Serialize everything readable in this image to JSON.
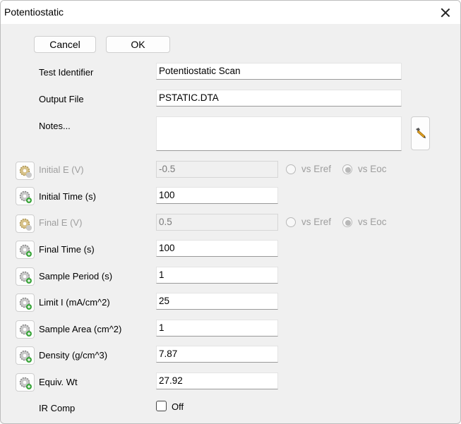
{
  "window": {
    "title": "Potentiostatic"
  },
  "buttons": {
    "cancel": "Cancel",
    "ok": "OK"
  },
  "fields": {
    "test_identifier": {
      "label": "Test Identifier",
      "value": "Potentiostatic Scan"
    },
    "output_file": {
      "label": "Output File",
      "value": "PSTATIC.DTA"
    },
    "notes": {
      "label": "Notes...",
      "value": ""
    },
    "initial_e": {
      "label": "Initial E (V)",
      "value": "-0.5",
      "enabled": false
    },
    "initial_time": {
      "label": "Initial Time (s)",
      "value": "100"
    },
    "final_e": {
      "label": "Final E (V)",
      "value": "0.5",
      "enabled": false
    },
    "final_time": {
      "label": "Final Time (s)",
      "value": "100"
    },
    "sample_period": {
      "label": "Sample Period (s)",
      "value": "1"
    },
    "limit_i": {
      "label": "Limit I (mA/cm^2)",
      "value": "25"
    },
    "sample_area": {
      "label": "Sample Area (cm^2)",
      "value": "1"
    },
    "density": {
      "label": "Density (g/cm^3)",
      "value": "7.87"
    },
    "equiv_wt": {
      "label": "Equiv. Wt",
      "value": "27.92"
    },
    "ir_comp": {
      "label": "IR Comp",
      "checkbox_label": "Off",
      "checked": false
    }
  },
  "radios": {
    "vs_eref": "vs Eref",
    "vs_eoc": "vs Eoc",
    "initial_e_selected": "vs Eoc",
    "final_e_selected": "vs Eoc"
  },
  "icons": {
    "close": "close-icon",
    "notes_editor": "pen-tool-icon",
    "settings": "gear-settings-icon"
  },
  "colors": {
    "disabled_text": "#9e9e9e",
    "window_bg": "#f0f0f0",
    "title_bg": "#ffffff"
  }
}
